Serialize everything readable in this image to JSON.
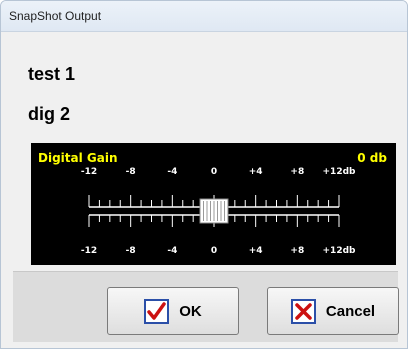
{
  "window": {
    "title": "SnapShot Output"
  },
  "lines": {
    "line1": "test 1",
    "line2": "dig 2"
  },
  "gain": {
    "label": "Digital Gain",
    "value_text": "0 db",
    "value": 0,
    "range": [
      -12,
      12
    ],
    "tick_labels": [
      "-12",
      "-8",
      "-4",
      "0",
      "+4",
      "+8",
      "+12db"
    ],
    "accent_color": "#ffff00"
  },
  "buttons": {
    "ok_label": "OK",
    "cancel_label": "Cancel"
  },
  "icons": {
    "ok": "checkmark-icon",
    "cancel": "x-cross-icon"
  },
  "colors": {
    "check": "#cc1111",
    "cross": "#cc1111",
    "icon_border": "#2b4fa8"
  }
}
